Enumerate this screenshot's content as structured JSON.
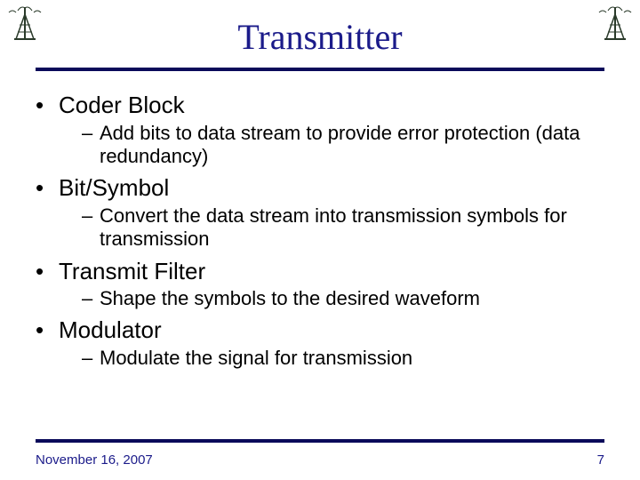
{
  "title": "Transmitter",
  "bullets": [
    {
      "label": "Coder Block",
      "sub": "Add bits to data stream to provide error protection (data redundancy)"
    },
    {
      "label": "Bit/Symbol",
      "sub": "Convert the data stream into transmission symbols for transmission"
    },
    {
      "label": "Transmit Filter",
      "sub": "Shape the symbols to the desired waveform"
    },
    {
      "label": "Modulator",
      "sub": "Modulate the signal for transmission"
    }
  ],
  "footer": {
    "date": "November 16, 2007",
    "page": "7"
  },
  "icons": {
    "antenna_alt": "antenna tower icon"
  }
}
